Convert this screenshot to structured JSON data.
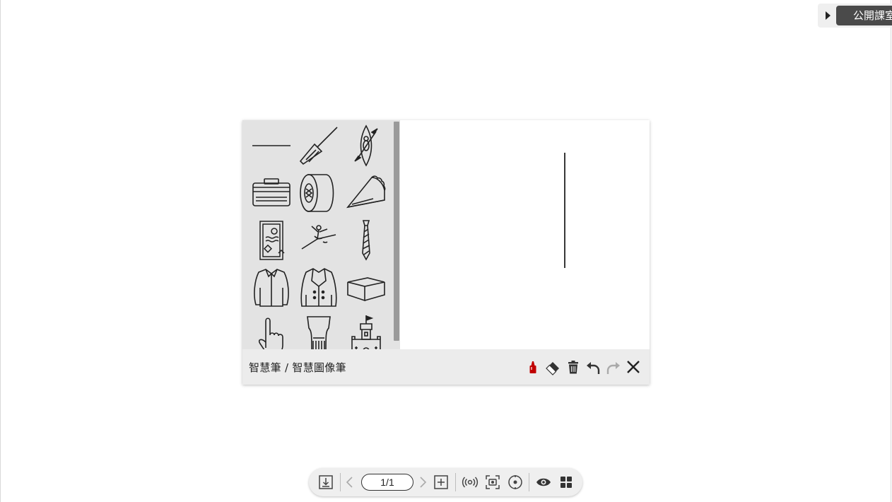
{
  "room_tab": {
    "name": "公開課室"
  },
  "pen_panel": {
    "title": "智慧筆 / 智慧圖像筆",
    "palette_items": [
      {
        "icon": "line-icon"
      },
      {
        "icon": "broom-icon"
      },
      {
        "icon": "kayak-icon"
      },
      {
        "icon": "cooler-box-icon"
      },
      {
        "icon": "tape-roll-icon"
      },
      {
        "icon": "pie-slice-icon"
      },
      {
        "icon": "certificate-icon"
      },
      {
        "icon": "ballet-dancer-icon"
      },
      {
        "icon": "necktie-icon"
      },
      {
        "icon": "shirt-icon"
      },
      {
        "icon": "coat-icon"
      },
      {
        "icon": "box-icon"
      },
      {
        "icon": "pointing-hand-icon"
      },
      {
        "icon": "glass-icon"
      },
      {
        "icon": "castle-icon"
      }
    ],
    "tools": {
      "pen_color": "#c00000",
      "pen": "pen-icon",
      "eraser": "eraser-icon",
      "clear": "trash-icon",
      "undo": "undo-icon",
      "redo": "redo-icon",
      "close": "close-icon"
    }
  },
  "toolbar": {
    "page_indicator": "1/1"
  }
}
